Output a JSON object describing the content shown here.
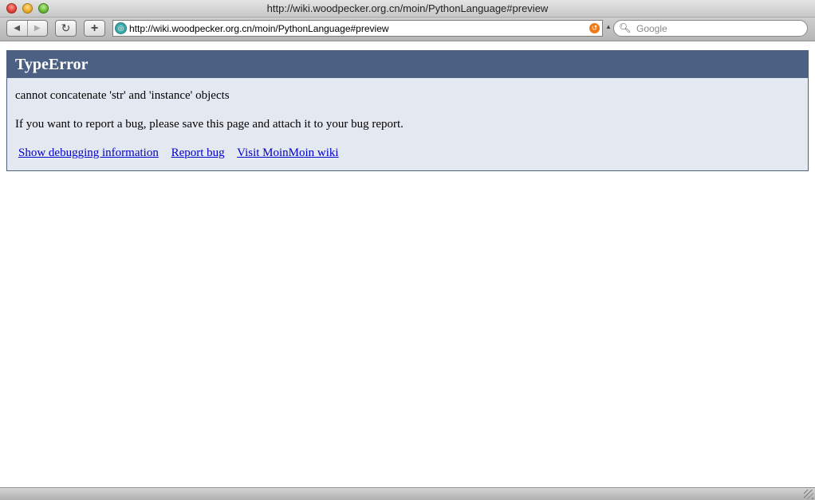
{
  "window": {
    "title": "http://wiki.woodpecker.org.cn/moin/PythonLanguage#preview"
  },
  "toolbar": {
    "back_icon": "◀",
    "forward_icon": "▶",
    "reload_icon": "↻",
    "add_icon": "+",
    "url": "http://wiki.woodpecker.org.cn/moin/PythonLanguage#preview",
    "search_placeholder": "Google"
  },
  "error": {
    "title": "TypeError",
    "message": "cannot concatenate 'str' and 'instance' objects",
    "hint": "If you want to report a bug, please save this page and attach it to your bug report.",
    "links": [
      {
        "label": "Show debugging information"
      },
      {
        "label": "Report bug"
      },
      {
        "label": "Visit MoinMoin wiki"
      }
    ]
  },
  "colors": {
    "header": "#4b6082",
    "panel": "#e4e8f0",
    "link": "#0000cc"
  }
}
